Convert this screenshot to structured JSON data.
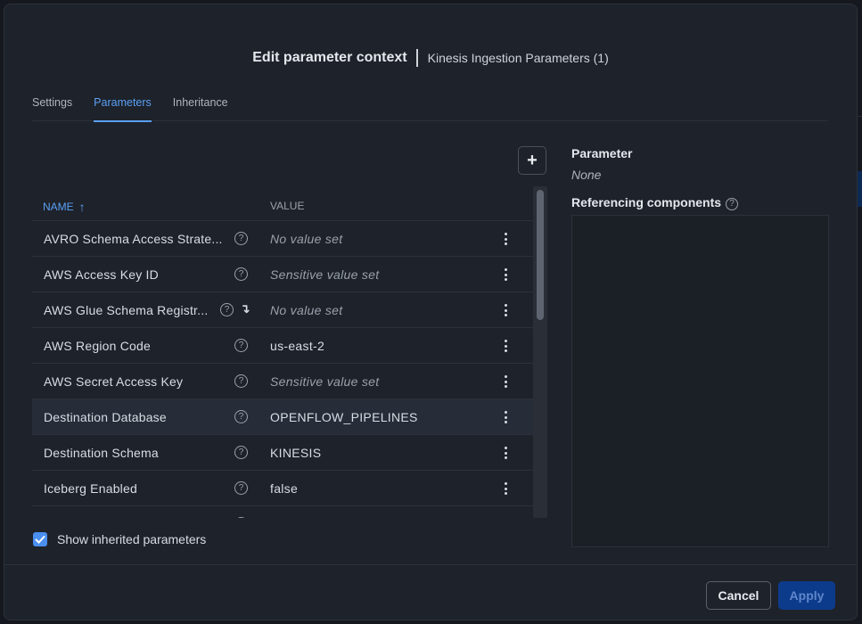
{
  "dialog": {
    "title": "Edit parameter context",
    "subtitle": "Kinesis Ingestion Parameters (1)"
  },
  "tabs": [
    {
      "label": "Settings",
      "active": false
    },
    {
      "label": "Parameters",
      "active": true
    },
    {
      "label": "Inheritance",
      "active": false
    }
  ],
  "toolbar": {
    "add_label": "+",
    "add_icon": "plus-icon"
  },
  "table": {
    "columns": {
      "name": "NAME",
      "value": "VALUE",
      "sort_icon": "arrow-up-icon"
    },
    "rows": [
      {
        "name": "AVRO Schema Access Strate...",
        "value": "No value set",
        "placeholder": true,
        "inherited": false,
        "selected": false
      },
      {
        "name": "AWS Access Key ID",
        "value": "Sensitive value set",
        "placeholder": true,
        "inherited": false,
        "selected": false
      },
      {
        "name": "AWS Glue Schema Registr...",
        "value": "No value set",
        "placeholder": true,
        "inherited": true,
        "selected": false
      },
      {
        "name": "AWS Region Code",
        "value": "us-east-2",
        "placeholder": false,
        "inherited": false,
        "selected": false
      },
      {
        "name": "AWS Secret Access Key",
        "value": "Sensitive value set",
        "placeholder": true,
        "inherited": false,
        "selected": false
      },
      {
        "name": "Destination Database",
        "value": "OPENFLOW_PIPELINES",
        "placeholder": false,
        "inherited": false,
        "selected": true
      },
      {
        "name": "Destination Schema",
        "value": "KINESIS",
        "placeholder": false,
        "inherited": false,
        "selected": false
      },
      {
        "name": "Iceberg Enabled",
        "value": "false",
        "placeholder": false,
        "inherited": false,
        "selected": false
      }
    ]
  },
  "show_inherited": {
    "label": "Show inherited parameters",
    "checked": true
  },
  "details": {
    "parameter_label": "Parameter",
    "parameter_value": "None",
    "referencing_label": "Referencing components"
  },
  "footer": {
    "cancel_label": "Cancel",
    "apply_label": "Apply"
  },
  "colors": {
    "accent": "#5aa0f5",
    "apply_bg": "#0d3b8c",
    "selected_row": "#262c38"
  }
}
